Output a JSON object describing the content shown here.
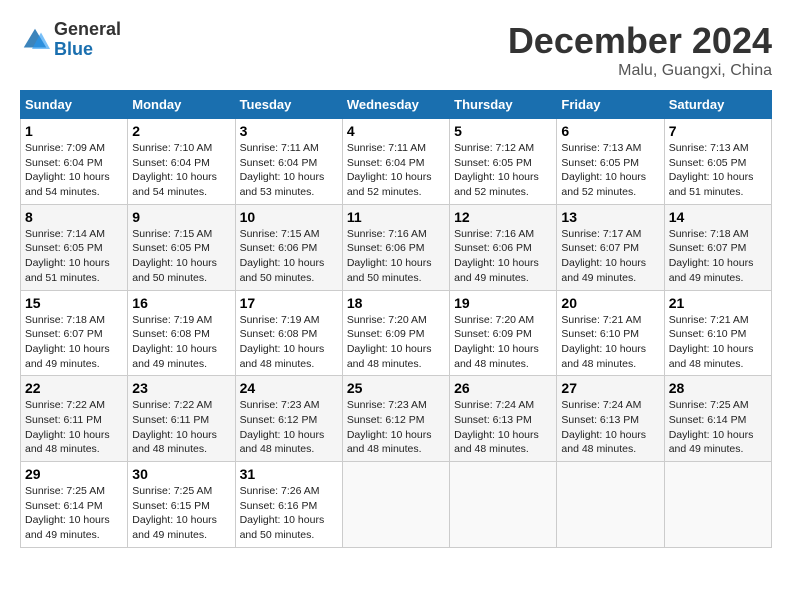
{
  "logo": {
    "general": "General",
    "blue": "Blue"
  },
  "title": "December 2024",
  "location": "Malu, Guangxi, China",
  "weekdays": [
    "Sunday",
    "Monday",
    "Tuesday",
    "Wednesday",
    "Thursday",
    "Friday",
    "Saturday"
  ],
  "weeks": [
    [
      {
        "day": "1",
        "sunrise": "7:09 AM",
        "sunset": "6:04 PM",
        "daylight": "10 hours and 54 minutes."
      },
      {
        "day": "2",
        "sunrise": "7:10 AM",
        "sunset": "6:04 PM",
        "daylight": "10 hours and 54 minutes."
      },
      {
        "day": "3",
        "sunrise": "7:11 AM",
        "sunset": "6:04 PM",
        "daylight": "10 hours and 53 minutes."
      },
      {
        "day": "4",
        "sunrise": "7:11 AM",
        "sunset": "6:04 PM",
        "daylight": "10 hours and 52 minutes."
      },
      {
        "day": "5",
        "sunrise": "7:12 AM",
        "sunset": "6:05 PM",
        "daylight": "10 hours and 52 minutes."
      },
      {
        "day": "6",
        "sunrise": "7:13 AM",
        "sunset": "6:05 PM",
        "daylight": "10 hours and 52 minutes."
      },
      {
        "day": "7",
        "sunrise": "7:13 AM",
        "sunset": "6:05 PM",
        "daylight": "10 hours and 51 minutes."
      }
    ],
    [
      {
        "day": "8",
        "sunrise": "7:14 AM",
        "sunset": "6:05 PM",
        "daylight": "10 hours and 51 minutes."
      },
      {
        "day": "9",
        "sunrise": "7:15 AM",
        "sunset": "6:05 PM",
        "daylight": "10 hours and 50 minutes."
      },
      {
        "day": "10",
        "sunrise": "7:15 AM",
        "sunset": "6:06 PM",
        "daylight": "10 hours and 50 minutes."
      },
      {
        "day": "11",
        "sunrise": "7:16 AM",
        "sunset": "6:06 PM",
        "daylight": "10 hours and 50 minutes."
      },
      {
        "day": "12",
        "sunrise": "7:16 AM",
        "sunset": "6:06 PM",
        "daylight": "10 hours and 49 minutes."
      },
      {
        "day": "13",
        "sunrise": "7:17 AM",
        "sunset": "6:07 PM",
        "daylight": "10 hours and 49 minutes."
      },
      {
        "day": "14",
        "sunrise": "7:18 AM",
        "sunset": "6:07 PM",
        "daylight": "10 hours and 49 minutes."
      }
    ],
    [
      {
        "day": "15",
        "sunrise": "7:18 AM",
        "sunset": "6:07 PM",
        "daylight": "10 hours and 49 minutes."
      },
      {
        "day": "16",
        "sunrise": "7:19 AM",
        "sunset": "6:08 PM",
        "daylight": "10 hours and 49 minutes."
      },
      {
        "day": "17",
        "sunrise": "7:19 AM",
        "sunset": "6:08 PM",
        "daylight": "10 hours and 48 minutes."
      },
      {
        "day": "18",
        "sunrise": "7:20 AM",
        "sunset": "6:09 PM",
        "daylight": "10 hours and 48 minutes."
      },
      {
        "day": "19",
        "sunrise": "7:20 AM",
        "sunset": "6:09 PM",
        "daylight": "10 hours and 48 minutes."
      },
      {
        "day": "20",
        "sunrise": "7:21 AM",
        "sunset": "6:10 PM",
        "daylight": "10 hours and 48 minutes."
      },
      {
        "day": "21",
        "sunrise": "7:21 AM",
        "sunset": "6:10 PM",
        "daylight": "10 hours and 48 minutes."
      }
    ],
    [
      {
        "day": "22",
        "sunrise": "7:22 AM",
        "sunset": "6:11 PM",
        "daylight": "10 hours and 48 minutes."
      },
      {
        "day": "23",
        "sunrise": "7:22 AM",
        "sunset": "6:11 PM",
        "daylight": "10 hours and 48 minutes."
      },
      {
        "day": "24",
        "sunrise": "7:23 AM",
        "sunset": "6:12 PM",
        "daylight": "10 hours and 48 minutes."
      },
      {
        "day": "25",
        "sunrise": "7:23 AM",
        "sunset": "6:12 PM",
        "daylight": "10 hours and 48 minutes."
      },
      {
        "day": "26",
        "sunrise": "7:24 AM",
        "sunset": "6:13 PM",
        "daylight": "10 hours and 48 minutes."
      },
      {
        "day": "27",
        "sunrise": "7:24 AM",
        "sunset": "6:13 PM",
        "daylight": "10 hours and 48 minutes."
      },
      {
        "day": "28",
        "sunrise": "7:25 AM",
        "sunset": "6:14 PM",
        "daylight": "10 hours and 49 minutes."
      }
    ],
    [
      {
        "day": "29",
        "sunrise": "7:25 AM",
        "sunset": "6:14 PM",
        "daylight": "10 hours and 49 minutes."
      },
      {
        "day": "30",
        "sunrise": "7:25 AM",
        "sunset": "6:15 PM",
        "daylight": "10 hours and 49 minutes."
      },
      {
        "day": "31",
        "sunrise": "7:26 AM",
        "sunset": "6:16 PM",
        "daylight": "10 hours and 50 minutes."
      },
      null,
      null,
      null,
      null
    ]
  ]
}
